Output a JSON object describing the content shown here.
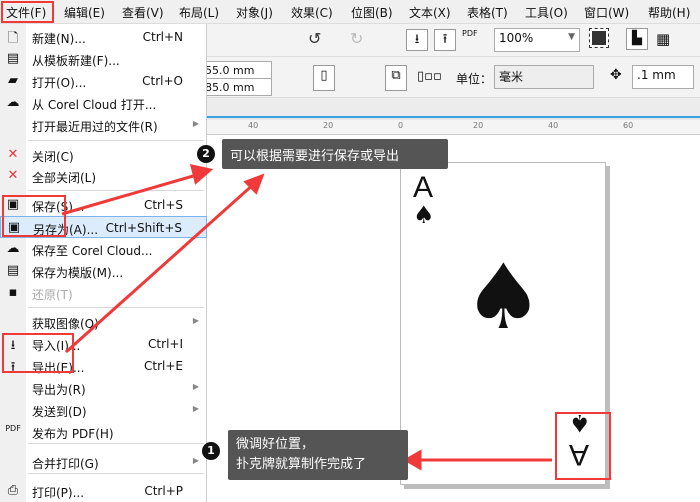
{
  "menubar": [
    "文件(F)",
    "编辑(E)",
    "查看(V)",
    "布局(L)",
    "对象(J)",
    "效果(C)",
    "位图(B)",
    "文本(X)",
    "表格(T)",
    "工具(O)",
    "窗口(W)",
    "帮助(H)"
  ],
  "toolbar": {
    "zoom": "100%",
    "width": "55.0 mm",
    "height": "85.0 mm",
    "unit_label": "单位：",
    "unit": "毫米",
    "nudge": ".1 mm",
    "pdf": "PDF"
  },
  "ruler": [
    "40",
    "20",
    "0",
    "20",
    "40",
    "60"
  ],
  "menu": [
    {
      "label": "新建(N)...",
      "shortcut": "Ctrl+N",
      "icon": "new-document-icon",
      "g": "🗋"
    },
    {
      "label": "从模板新建(F)...",
      "icon": "new-from-template-icon",
      "g": "▤"
    },
    {
      "label": "打开(O)...",
      "shortcut": "Ctrl+O",
      "icon": "folder-icon",
      "g": "▰"
    },
    {
      "label": "从 Corel Cloud 打开...",
      "icon": "cloud-download-icon",
      "g": "☁"
    },
    {
      "label": "打开最近用过的文件(R)",
      "submenu": true
    },
    {
      "label": "关闭(C)",
      "icon": "close-document-icon",
      "g": "✕"
    },
    {
      "label": "全部关闭(L)",
      "icon": "close-all-icon",
      "g": "✕"
    },
    {
      "label": "保存(S)...",
      "shortcut": "Ctrl+S",
      "icon": "save-icon",
      "g": "▣"
    },
    {
      "label": "另存为(A)...",
      "shortcut": "Ctrl+Shift+S",
      "icon": "save-as-icon",
      "g": "▣"
    },
    {
      "label": "保存至 Corel Cloud...",
      "icon": "cloud-upload-icon",
      "g": "☁"
    },
    {
      "label": "保存为模版(M)...",
      "icon": "save-template-icon",
      "g": "▤"
    },
    {
      "label": "还原(T)",
      "disabled": true,
      "icon": "revert-icon",
      "g": "▪"
    },
    {
      "label": "获取图像(Q)",
      "submenu": true
    },
    {
      "label": "导入(I)...",
      "shortcut": "Ctrl+I",
      "icon": "import-icon",
      "g": "⭳"
    },
    {
      "label": "导出(E)...",
      "shortcut": "Ctrl+E",
      "icon": "export-icon",
      "g": "⭱"
    },
    {
      "label": "导出为(R)",
      "submenu": true
    },
    {
      "label": "发送到(D)",
      "submenu": true
    },
    {
      "label": "发布为 PDF(H)",
      "icon": "pdf-icon",
      "g": "PDF"
    },
    {
      "label": "合并打印(G)",
      "submenu": true
    },
    {
      "label": "打印(P)...",
      "shortcut": "Ctrl+P",
      "icon": "print-icon",
      "g": "⎙"
    }
  ],
  "card": {
    "rank": "A",
    "suit": "♠"
  },
  "callouts": [
    {
      "num": "2",
      "text": "可以根据需要进行保存或导出"
    },
    {
      "num": "1",
      "text": "微调好位置，",
      "text2": "扑克牌就算制作完成了"
    }
  ],
  "colors": {
    "annotation": "#f03a3a",
    "highlight": "#dcecfc"
  }
}
